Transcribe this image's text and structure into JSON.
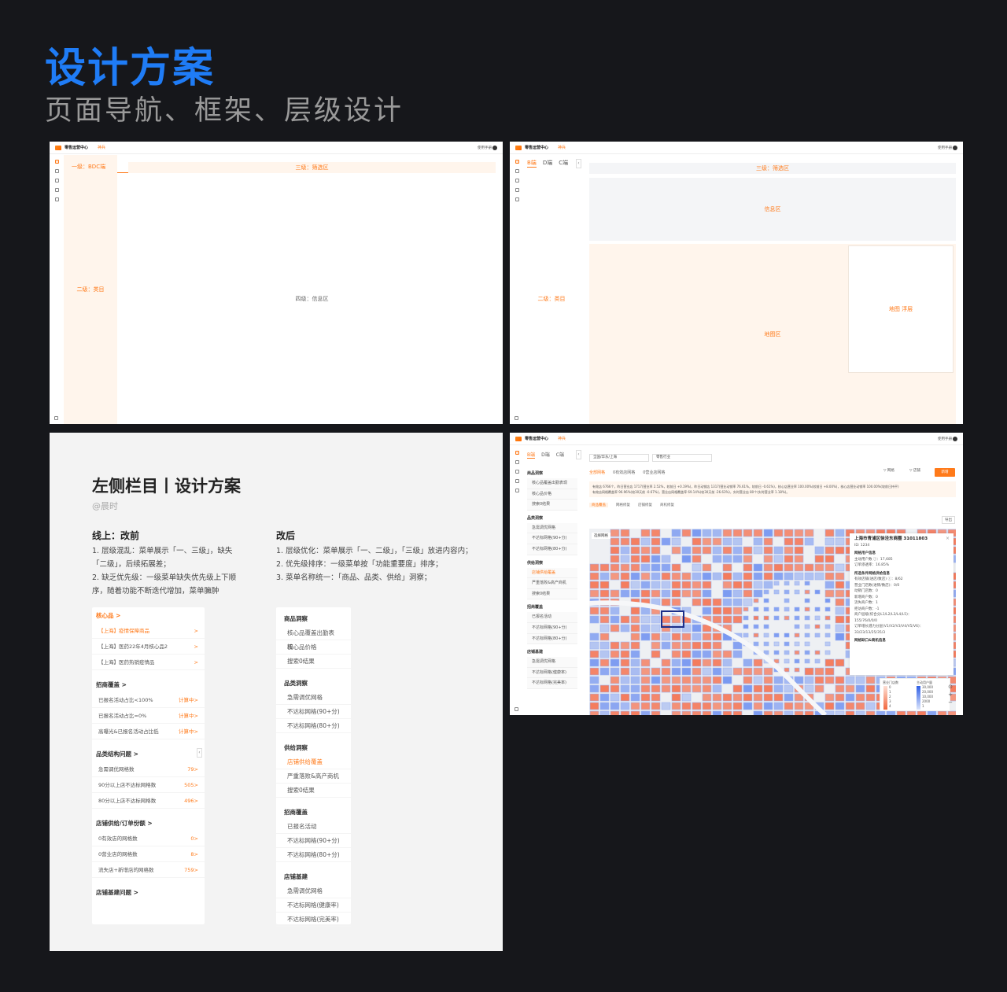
{
  "hero": {
    "title": "设计方案",
    "subtitle": "页面导航、框架、层级设计"
  },
  "app": {
    "brand": "零售运营中心",
    "nav_tab": "神兵",
    "manual": "使用手册"
  },
  "p1": {
    "level1": "一级：BDC端",
    "level2": "二级：类目",
    "level3": "三级：筛选区",
    "level4": "四级：信息区"
  },
  "p2": {
    "tabs": [
      "B端",
      "D端",
      "C端"
    ],
    "level2": "二级：类目",
    "level3": "三级：筛选区",
    "info": "信息区",
    "map": "地图区",
    "float": "地图 浮层"
  },
  "p3": {
    "title": "左侧栏目丨设计方案",
    "author": "@晨时",
    "before_title": "线上：改前",
    "before_items": [
      "1. 层级混乱：菜单展示「一、三级」，缺失",
      "「二级」，后续拓展差；",
      "2. 缺乏优先级：一级菜单缺失优先级上下顺",
      "序，随着功能不断迭代增加，菜单臃肿"
    ],
    "after_title": "改后",
    "after_items": [
      "1. 层级优化：菜单展示「一、二级」，「三级」放进内容内；",
      "2. 优先级排序：一级菜单按「功能重要度」排序；",
      "3. 菜单名称统一：「商品、品类、供给」洞察；"
    ],
    "old_menu": [
      {
        "title": "核心品 >",
        "orange": true,
        "rows": [
          {
            "label": "【上海】疫情保障商品",
            "value": ">",
            "orange": true
          },
          {
            "label": "【上海】医药22年4月核心品2",
            "value": ">"
          },
          {
            "label": "【上海】医药热销疫情品",
            "value": ">"
          }
        ]
      },
      {
        "title": "招商覆盖 >",
        "rows": [
          {
            "label": "已报名活动占比<100%",
            "value": "计算中>"
          },
          {
            "label": "已报名活动占比=0%",
            "value": "计算中>"
          },
          {
            "label": "高曝光&已报名活动占比低",
            "value": "计算中>"
          }
        ]
      },
      {
        "title": "品类结构问题 >",
        "rows": [
          {
            "label": "急需调优网格数",
            "value": "79>"
          },
          {
            "label": "90分以上店不达标网格数",
            "value": "505>"
          },
          {
            "label": "80分以上店不达标网格数",
            "value": "496>"
          }
        ]
      },
      {
        "title": "店铺供给/订单份额 >",
        "rows": [
          {
            "label": "0有效店的网格数",
            "value": "0>"
          },
          {
            "label": "0营业店的网格数",
            "value": "8>"
          },
          {
            "label": "流失店+新增店的网格数",
            "value": "759>"
          }
        ]
      },
      {
        "title": "店铺基建问题 >",
        "rows": []
      }
    ],
    "new_menu": [
      {
        "title": "商品洞察",
        "rows": [
          {
            "label": "核心品覆盖出勤表现"
          },
          {
            "label": "核心品价格"
          },
          {
            "label": "搜索0结果"
          }
        ]
      },
      {
        "title": "品类洞察",
        "rows": [
          {
            "label": "急需调优网格"
          },
          {
            "label": "不达标网格(90+分)"
          },
          {
            "label": "不达标网格(80+分)"
          }
        ]
      },
      {
        "title": "供给洞察",
        "rows": [
          {
            "label": "店铺供给覆盖",
            "orange": true
          },
          {
            "label": "严重落败&高产商机"
          },
          {
            "label": "搜索0结果"
          }
        ]
      },
      {
        "title": "招商覆盖",
        "rows": [
          {
            "label": "已报名活动"
          },
          {
            "label": "不达标网格(90+分)"
          },
          {
            "label": "不达标网格(80+分)"
          }
        ]
      },
      {
        "title": "店铺基建",
        "rows": [
          {
            "label": "急需调优网格"
          },
          {
            "label": "不达标网格(健康率)"
          },
          {
            "label": "不达标网格(完美率)"
          }
        ]
      }
    ]
  },
  "p4": {
    "tabs": [
      "B端",
      "D端",
      "C端"
    ],
    "region_select": "全国/华东/上海",
    "industry_select": "零售行业",
    "subtabs": [
      "全部网格",
      "0有效店网格",
      "0营业店网格"
    ],
    "actions": [
      "网格",
      "店铺"
    ],
    "new_button": "新增",
    "stats_line1": "有效店 6766个，昨日营业店 1717(营业率 2.52%，较前日 +0.19%)，昨日动销店 1317(营业动销率 76.61%，较前日 -0.61%)，核心店营业率 100.00%(较前日 +8.00%)，核心店营业动销率 100.00%(较前日持平)",
    "stats_line2": "有效店网格覆盖率 96.96%(较30天前 -0.67%)，营业店网格覆盖率 69.14%(较30天前 -26.63%)，实时营业店 80个(实时营业率 1.18%)。",
    "subtabs2": [
      "商品覆盖",
      "网格修复",
      "店铺修复",
      "商机修复"
    ],
    "export": "导出",
    "select_grid": "选择网格",
    "sidenav": [
      {
        "group": "商品洞察",
        "items": [
          {
            "label": "核心品覆盖出勤表现"
          },
          {
            "label": "核心品价格"
          },
          {
            "label": "搜索0结果"
          }
        ]
      },
      {
        "group": "品类洞察",
        "items": [
          {
            "label": "急需调优网格"
          },
          {
            "label": "不达标网格(90+分)"
          },
          {
            "label": "不达标网格(80+分)"
          }
        ]
      },
      {
        "group": "供给洞察",
        "items": [
          {
            "label": "店铺供给覆盖",
            "orange": true
          },
          {
            "label": "严重落败&高产商机"
          },
          {
            "label": "搜索0结果"
          }
        ]
      },
      {
        "group": "招商覆盖",
        "items": [
          {
            "label": "已报名活动"
          },
          {
            "label": "不达标网格(90+分)"
          },
          {
            "label": "不达标网格(80+分)"
          }
        ]
      },
      {
        "group": "店铺基建",
        "items": [
          {
            "label": "急需调优网格"
          },
          {
            "label": "不达标网格(健康率)"
          },
          {
            "label": "不达标网格(完美率)"
          }
        ]
      }
    ],
    "mapcard": {
      "title": "上海市青浦区徐泾东商圈 31011803",
      "id": "ID: 1234",
      "sec1": "网格用户信息",
      "lines1": [
        "主动用户数 ⓘ：17,685",
        "订单渗透率：16.85%"
      ],
      "sec2": "所选条件网格供给信息",
      "lines2": [
        "有效店铺(进店/数店) ⓘ：8/62",
        "营业门店数(进销/数店)：0/0",
        "动销门店数：0",
        "新增商户数：0",
        "流失商户数：1",
        "拒访商户数：-1",
        "商户层级(综合分L1/L2/L3/L4/L5)：",
        "155/76/0/0/0",
        "订单增长潜力分层(V1/V2/V3/V4/V5/V6)：",
        "33/23/13/25/35/3"
      ],
      "sec3": "网格缺口&商机信息"
    },
    "legend": {
      "left_title": "营业门店数",
      "right_title": "主动用户量",
      "left_vals": [
        "0",
        "1",
        "2",
        "3",
        "4"
      ],
      "right_vals": [
        "30,000",
        "20,000",
        "10,000",
        "2000",
        "1"
      ]
    },
    "zoom": [
      "⊙",
      "+",
      "−"
    ]
  },
  "colors": {
    "accent": "#ff7a1a",
    "hero_blue": "#1f7cf6",
    "map_orange": "#f47b5c",
    "map_blue": "#6b8ef0"
  }
}
